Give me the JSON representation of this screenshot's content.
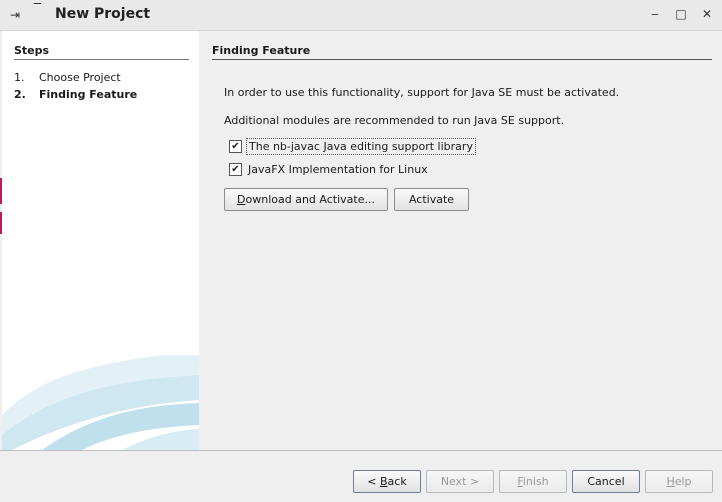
{
  "window": {
    "title": "New Project",
    "pin_icon": "⇥",
    "minimize_left_icon": "‾",
    "controls": {
      "minimize": "‒",
      "maximize": "□",
      "close": "✕"
    }
  },
  "steps": {
    "heading": "Steps",
    "items": [
      {
        "num": "1.",
        "label": "Choose Project"
      },
      {
        "num": "2.",
        "label": "Finding Feature"
      }
    ]
  },
  "main": {
    "section_title": "Finding Feature",
    "message": "In order to use this functionality, support for Java SE must be activated.",
    "additional": "Additional modules are recommended to run Java SE support.",
    "modules": [
      {
        "label": "The nb-javac Java editing support library",
        "checked": true
      },
      {
        "label": "JavaFX Implementation for Linux",
        "checked": true
      }
    ],
    "download_button": {
      "prefix": "",
      "mnemonic": "D",
      "rest": "ownload and Activate..."
    },
    "activate_button": "Activate"
  },
  "footer": {
    "back": {
      "prefix": "< ",
      "mnemonic": "B",
      "rest": "ack"
    },
    "next": "Next >",
    "finish": {
      "prefix": "",
      "mnemonic": "F",
      "rest": "inish"
    },
    "cancel": "Cancel",
    "help": {
      "prefix": "",
      "mnemonic": "H",
      "rest": "elp"
    }
  },
  "colors": {
    "accent_pink": "#c2185b",
    "swoosh_light": "#d9edf5",
    "swoosh_mid": "#b7dcea"
  }
}
